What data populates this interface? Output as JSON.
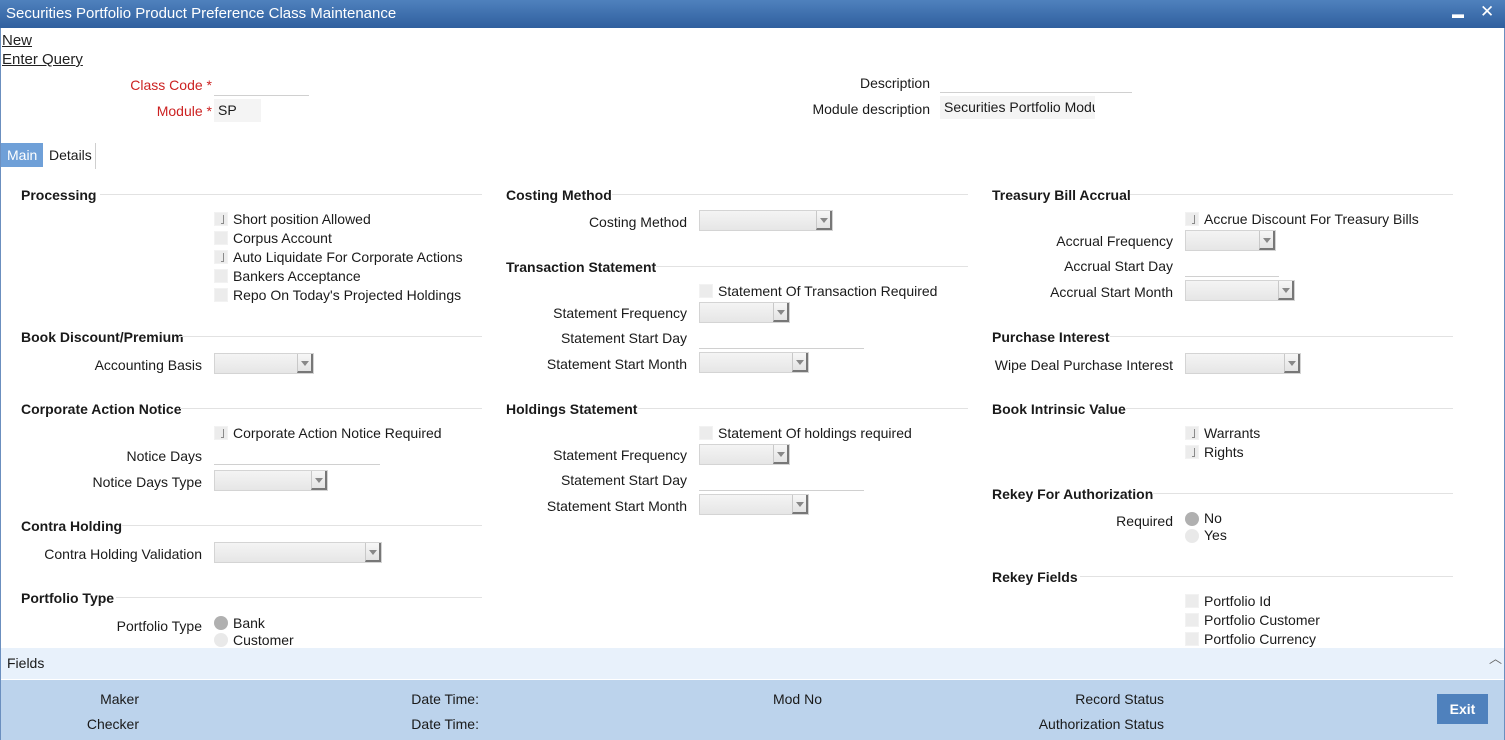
{
  "window": {
    "title": "Securities Portfolio Product Preference Class Maintenance",
    "minimize_glyph": "▬",
    "close_glyph": "✕"
  },
  "actions": {
    "new": "New",
    "enter_query": "Enter Query"
  },
  "header": {
    "class_code_label": "Class Code",
    "class_code_value": "",
    "module_label": "Module",
    "module_value": "SP",
    "required_marker": "*",
    "description_label": "Description",
    "description_value": "",
    "module_description_label": "Module description",
    "module_description_value": "Securities Portfolio Modul"
  },
  "tabs": [
    {
      "label": "Main",
      "active": true
    },
    {
      "label": "Details",
      "active": false
    }
  ],
  "processing": {
    "title": "Processing",
    "options": [
      {
        "label": "Short position Allowed",
        "checked": true
      },
      {
        "label": "Corpus Account",
        "checked": false
      },
      {
        "label": "Auto Liquidate For Corporate Actions",
        "checked": true
      },
      {
        "label": "Bankers Acceptance",
        "checked": false
      },
      {
        "label": "Repo On Today's Projected Holdings",
        "checked": false
      }
    ]
  },
  "book_discount": {
    "title": "Book Discount/Premium",
    "accounting_basis_label": "Accounting Basis",
    "accounting_basis_value": ""
  },
  "corporate_action": {
    "title": "Corporate Action Notice",
    "notice_required_label": "Corporate Action Notice Required",
    "notice_days_label": "Notice Days",
    "notice_days_value": "",
    "notice_days_type_label": "Notice Days Type",
    "notice_days_type_value": ""
  },
  "contra_holding": {
    "title": "Contra Holding",
    "validation_label": "Contra Holding Validation",
    "validation_value": ""
  },
  "portfolio_type": {
    "title": "Portfolio Type",
    "label": "Portfolio Type",
    "options": [
      {
        "label": "Bank",
        "selected": true
      },
      {
        "label": "Customer",
        "selected": false
      }
    ]
  },
  "costing": {
    "title": "Costing Method",
    "label": "Costing Method",
    "value": ""
  },
  "transaction_statement": {
    "title": "Transaction Statement",
    "required_label": "Statement Of Transaction Required",
    "frequency_label": "Statement Frequency",
    "start_day_label": "Statement Start Day",
    "start_month_label": "Statement Start Month"
  },
  "holdings_statement": {
    "title": "Holdings Statement",
    "required_label": "Statement Of holdings required",
    "frequency_label": "Statement Frequency",
    "start_day_label": "Statement Start Day",
    "start_month_label": "Statement Start Month"
  },
  "treasury": {
    "title": "Treasury Bill Accrual",
    "accrue_label": "Accrue Discount For Treasury Bills",
    "frequency_label": "Accrual Frequency",
    "start_day_label": "Accrual Start Day",
    "start_month_label": "Accrual Start Month"
  },
  "purchase_interest": {
    "title": "Purchase Interest",
    "wipe_label": "Wipe Deal Purchase Interest"
  },
  "intrinsic": {
    "title": "Book Intrinsic Value",
    "options": [
      {
        "label": "Warrants",
        "checked": true
      },
      {
        "label": "Rights",
        "checked": true
      }
    ]
  },
  "rekey_auth": {
    "title": "Rekey For Authorization",
    "required_label": "Required",
    "options": [
      {
        "label": "No",
        "selected": true
      },
      {
        "label": "Yes",
        "selected": false
      }
    ]
  },
  "rekey_fields": {
    "title": "Rekey Fields",
    "options": [
      {
        "label": "Portfolio Id"
      },
      {
        "label": "Portfolio Customer"
      },
      {
        "label": "Portfolio Currency"
      }
    ]
  },
  "fields_bar": {
    "label": "Fields",
    "scroll_glyph": "︿"
  },
  "footer": {
    "maker_label": "Maker",
    "checker_label": "Checker",
    "date_time_label": "Date Time:",
    "mod_no_label": "Mod No",
    "record_status_label": "Record Status",
    "auth_status_label": "Authorization Status",
    "exit_label": "Exit"
  },
  "colors": {
    "title_bar": "#2f5f9e",
    "active_tab": "#6fa0d8",
    "required": "#cc2222",
    "footer": "#bcd3ec",
    "exit_button": "#4f81bd"
  }
}
